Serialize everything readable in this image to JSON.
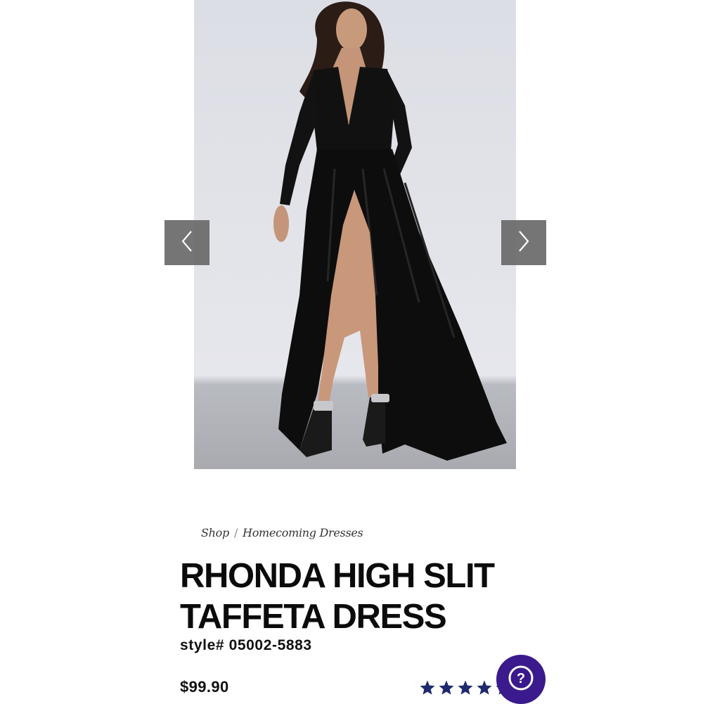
{
  "carousel": {
    "image_alt": "Model wearing long-sleeve black taffeta gown with high slit",
    "prev_icon": "chevron-left-icon",
    "next_icon": "chevron-right-icon"
  },
  "breadcrumb": {
    "items": [
      "Shop",
      "Homecoming Dresses"
    ],
    "separator": "/"
  },
  "product": {
    "title": "RHONDA HIGH SLIT TAFFETA DRESS",
    "style": "style# 05002-5883",
    "price": "$99.90",
    "rating_stars": 5
  },
  "help": {
    "icon": "question-mark-icon",
    "label": "?"
  },
  "colors": {
    "help_button": "#3a1a8c",
    "stars": "#1e2a6e",
    "carousel_button": "#696969"
  }
}
